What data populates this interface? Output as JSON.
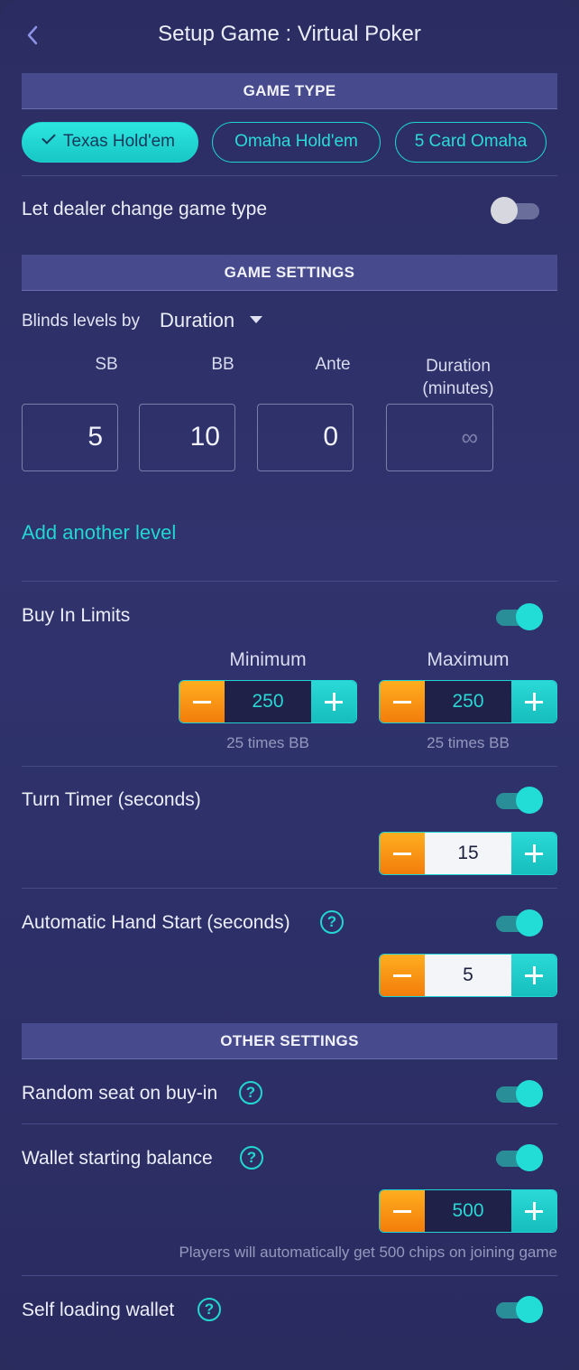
{
  "header": {
    "title": "Setup Game : Virtual Poker"
  },
  "sections": {
    "game_type": "GAME TYPE",
    "game_settings": "GAME SETTINGS",
    "other_settings": "OTHER SETTINGS"
  },
  "game_types": [
    {
      "label": "Texas Hold'em",
      "selected": true
    },
    {
      "label": "Omaha Hold'em",
      "selected": false
    },
    {
      "label": "5 Card Omaha",
      "selected": false
    }
  ],
  "dealer_change": {
    "label": "Let dealer change game type",
    "enabled": false
  },
  "blinds": {
    "by_label": "Blinds levels by",
    "by_value": "Duration",
    "columns": {
      "sb": "SB",
      "bb": "BB",
      "ante": "Ante",
      "duration": "Duration (minutes)"
    },
    "values": {
      "sb": "5",
      "bb": "10",
      "ante": "0",
      "duration": "∞"
    },
    "add_level": "Add another level"
  },
  "buy_in": {
    "label": "Buy In Limits",
    "enabled": true,
    "min_label": "Minimum",
    "max_label": "Maximum",
    "min_value": "250",
    "max_value": "250",
    "min_note": "25 times BB",
    "max_note": "25 times BB"
  },
  "turn_timer": {
    "label": "Turn Timer (seconds)",
    "enabled": true,
    "value": "15"
  },
  "auto_start": {
    "label": "Automatic Hand Start (seconds)",
    "enabled": true,
    "value": "5"
  },
  "random_seat": {
    "label": "Random seat on buy-in",
    "enabled": true
  },
  "wallet": {
    "label": "Wallet starting balance",
    "enabled": true,
    "value": "500",
    "note": "Players will automatically get 500 chips on joining game"
  },
  "self_loading": {
    "label": "Self loading wallet",
    "enabled": true
  },
  "help_glyph": "?",
  "colors": {
    "accent": "#22dcd6",
    "minus": "#f5890f",
    "section_bar": "#474b8d"
  }
}
